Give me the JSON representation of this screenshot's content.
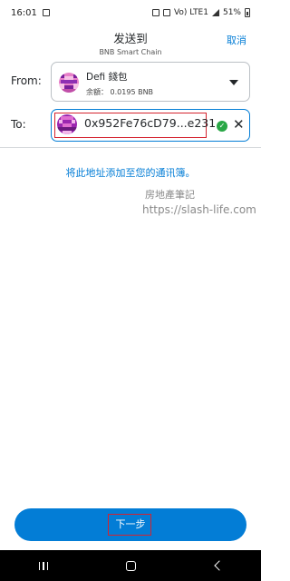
{
  "status_bar": {
    "time": "16:01",
    "battery": "51%",
    "network_labels": "Vo) LTE1"
  },
  "header": {
    "title": "发送到",
    "network": "BNB Smart Chain",
    "cancel_label": "取消"
  },
  "from": {
    "label": "From:",
    "account_name": "Defi 錢包",
    "balance": "余額： 0.0195 BNB"
  },
  "to": {
    "label": "To:",
    "address": "0x952Fe76cD79...e231"
  },
  "add_contact_label": "将此地址添加至您的通讯簿。",
  "watermark": {
    "name": "房地產筆記",
    "url": "https://slash-life.com"
  },
  "next_button_label": "下一步",
  "colors": {
    "accent": "#037dd6",
    "highlight": "#d4232f",
    "success": "#28a745"
  },
  "icons": {
    "from_dropdown": "chevron-down-icon",
    "to_verified": "check-circle-icon",
    "to_clear": "close-icon"
  }
}
